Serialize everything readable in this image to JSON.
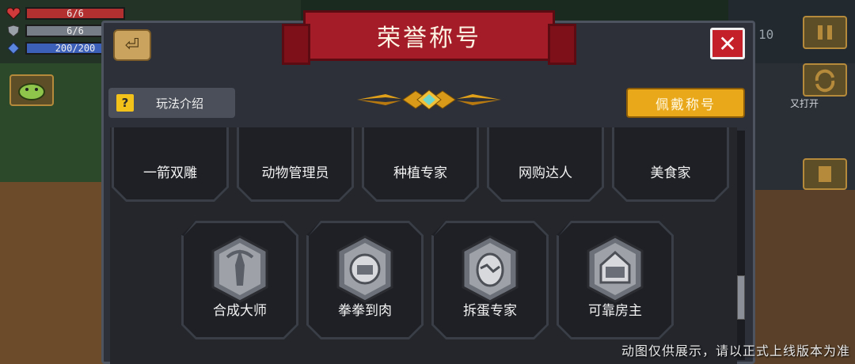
{
  "hud": {
    "hp": {
      "text": "6/6",
      "fraction": 1.0,
      "color": "#b33030"
    },
    "armor": {
      "text": "6/6",
      "fraction": 1.0,
      "color": "#777d86"
    },
    "energy": {
      "text": "200/200",
      "fraction": 1.0,
      "color": "#3c5fb8"
    },
    "level_text": "10",
    "side_note": "又打开"
  },
  "dialog": {
    "title": "荣誉称号",
    "help_label": "玩法介绍",
    "help_icon": "?",
    "equip_label": "佩戴称号",
    "close_icon": "✕",
    "back_icon": "⏎",
    "scroll_fraction": 0.78
  },
  "titles_row1": [
    {
      "name": "一箭双雕",
      "icon": "bow-badge-icon"
    },
    {
      "name": "动物管理员",
      "icon": "animal-badge-icon"
    },
    {
      "name": "种植专家",
      "icon": "plant-badge-icon"
    },
    {
      "name": "网购达人",
      "icon": "shop-badge-icon"
    },
    {
      "name": "美食家",
      "icon": "food-badge-icon"
    }
  ],
  "titles_row2": [
    {
      "name": "合成大师",
      "icon": "forge-badge-icon"
    },
    {
      "name": "拳拳到肉",
      "icon": "fist-badge-icon"
    },
    {
      "name": "拆蛋专家",
      "icon": "egg-badge-icon"
    },
    {
      "name": "可靠房主",
      "icon": "house-1p-badge-icon"
    }
  ],
  "caption": "动图仅供展示，请以正式上线版本为准",
  "colors": {
    "accent_gold": "#e9a81a",
    "banner_red": "#a41c28",
    "close_red": "#c3202a",
    "panel": "#2d3038"
  }
}
